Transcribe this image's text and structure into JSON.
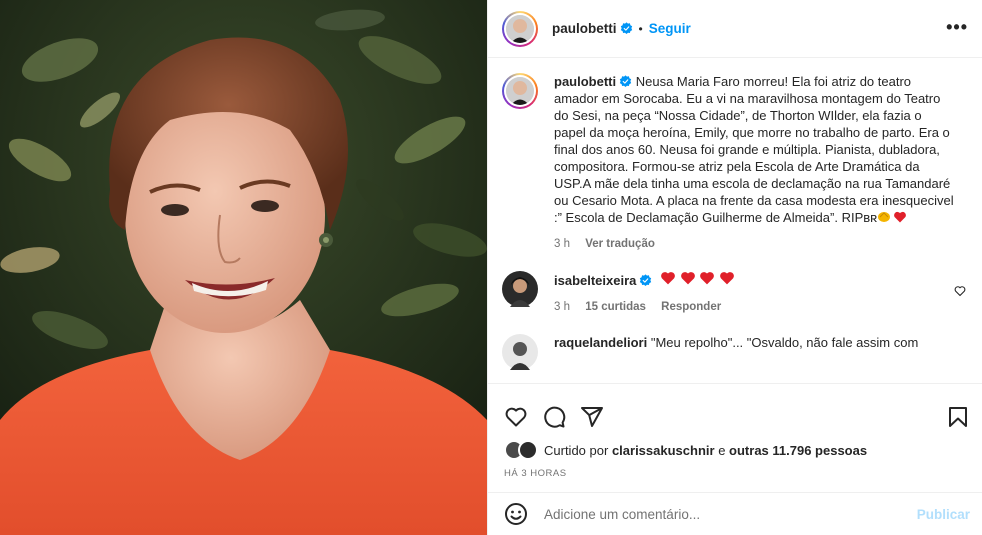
{
  "post": {
    "username": "paulobetti",
    "follow_label": "Seguir",
    "separator": "•",
    "more_label": "•••"
  },
  "caption": {
    "username": "paulobetti",
    "text": "Neusa Maria Faro morreu! Ela foi atriz do teatro amador em Sorocaba. Eu a vi na maravilhosa montagem do Teatro do Sesi, na peça “Nossa Cidade”, de Thorton WIlder, ela fazia o papel da moça heroína, Emily, que morre no trabalho de parto. Era o final dos anos 60. Neusa foi grande e múltipla. Pianista, dubladora, compositora. Formou-se atriz pela Escola de Arte Dramática da USP.A mãe dela tinha uma escola de declamação na rua Tamandaré ou Cesario Mota. A placa na frente da casa modesta era inesquecivel :” Escola de Declamação Guilherme de Almeida”. RIPʙʀ",
    "time": "3 h",
    "translate_label": "Ver tradução"
  },
  "comments": [
    {
      "username": "isabelteixeira",
      "text": "",
      "hearts": 4,
      "time": "3 h",
      "likes": "15 curtidas",
      "reply_label": "Responder"
    },
    {
      "username": "raquelandeliori",
      "text": "\"Meu repolho\"... \"Osvaldo, não fale assim com"
    }
  ],
  "likes": {
    "prefix": "Curtido por",
    "user": "clarissakuschnir",
    "middle": "e",
    "others": "outras 11.796 pessoas"
  },
  "timestamp": "HÁ 3 HORAS",
  "composer": {
    "placeholder": "Adicione um comentário...",
    "publish_label": "Publicar"
  },
  "colors": {
    "link": "#0095f6",
    "heart": "#ed4956",
    "publish_disabled": "#b2dffc",
    "meta_text": "#737373"
  },
  "icons": [
    "verified-badge-icon",
    "more-options-icon",
    "heart-icon",
    "comment-icon",
    "share-icon",
    "bookmark-icon",
    "emoji-icon",
    "small-heart-icon",
    "clapping-hands-emoji"
  ]
}
